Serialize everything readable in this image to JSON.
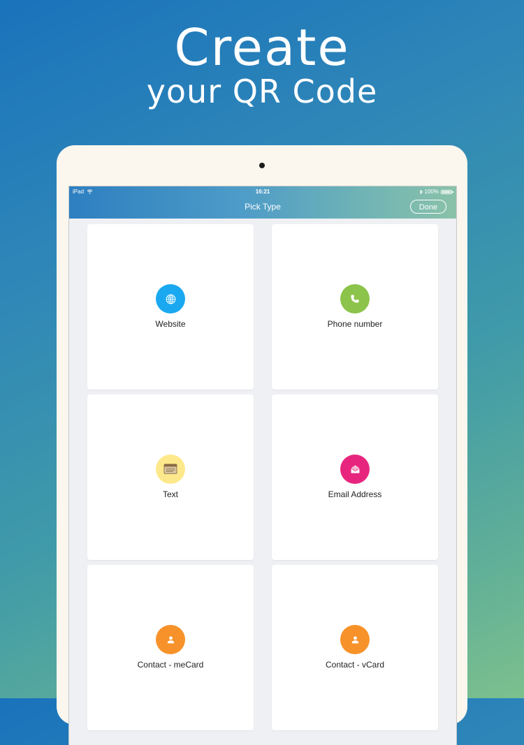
{
  "hero": {
    "line1": "Create",
    "line2": "your QR Code"
  },
  "status_bar": {
    "device": "iPad",
    "time": "16:21",
    "battery": "100%"
  },
  "nav": {
    "title": "Pick Type",
    "done_label": "Done"
  },
  "tiles": [
    {
      "label": "Website",
      "icon": "globe-icon",
      "color": "#1aa9f1"
    },
    {
      "label": "Phone number",
      "icon": "phone-icon",
      "color": "#8cc34a"
    },
    {
      "label": "Text",
      "icon": "text-note-icon",
      "color": "#fde98b"
    },
    {
      "label": "Email Address",
      "icon": "envelope-icon",
      "color": "#e8257e"
    },
    {
      "label": "Contact - meCard",
      "icon": "person-icon",
      "color": "#f7922a"
    },
    {
      "label": "Contact - vCard",
      "icon": "person-icon",
      "color": "#f7922a"
    }
  ]
}
